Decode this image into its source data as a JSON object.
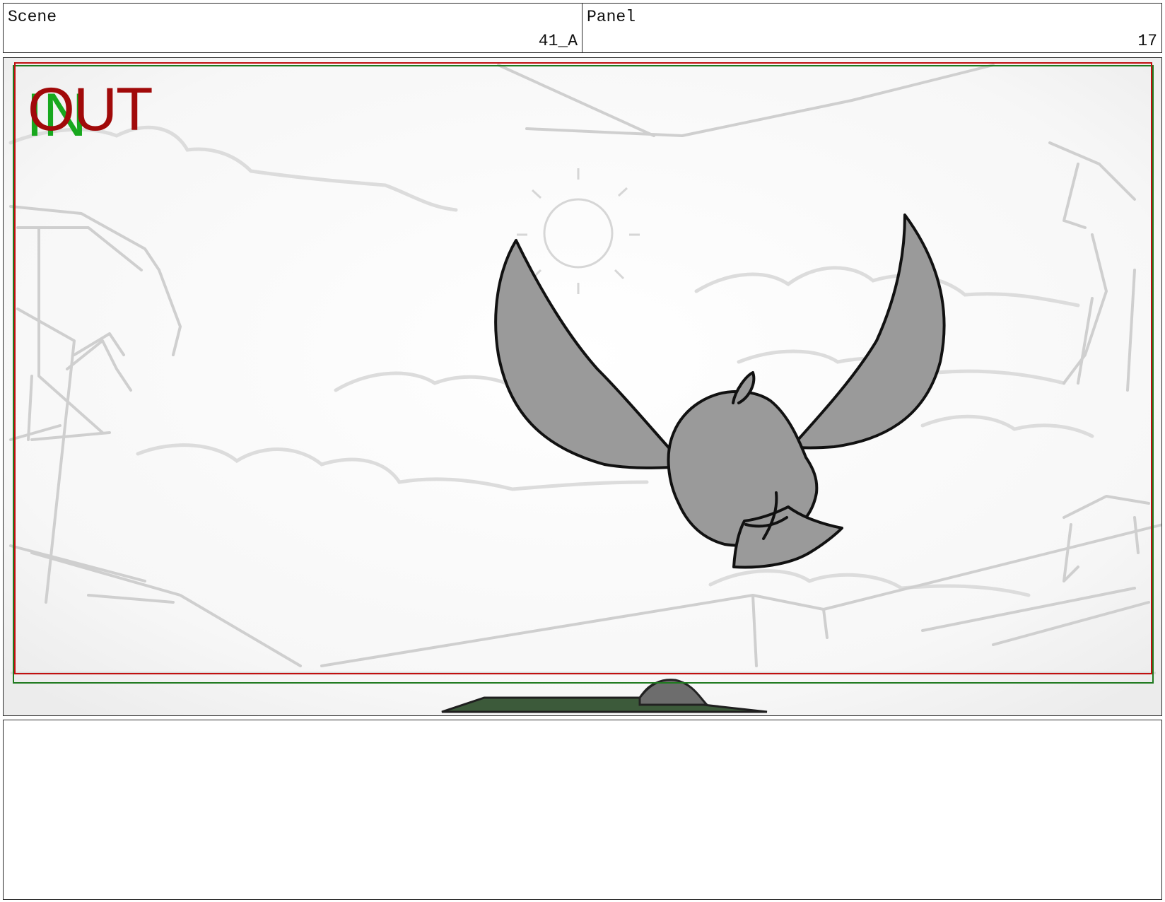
{
  "header": {
    "scene_label": "Scene",
    "scene_value": "41_A",
    "panel_label": "Panel",
    "panel_value": "17"
  },
  "frame": {
    "in_marker": "IN",
    "out_marker": "OUT",
    "colors": {
      "in": "#18a81e",
      "out": "#a10a0a",
      "safe_area_green": "#1f7a1f",
      "safe_area_red": "#c01010",
      "character_fill": "#9a9a9a",
      "foreground_fill": "#3c5a3a"
    }
  },
  "notes": {
    "text": ""
  }
}
